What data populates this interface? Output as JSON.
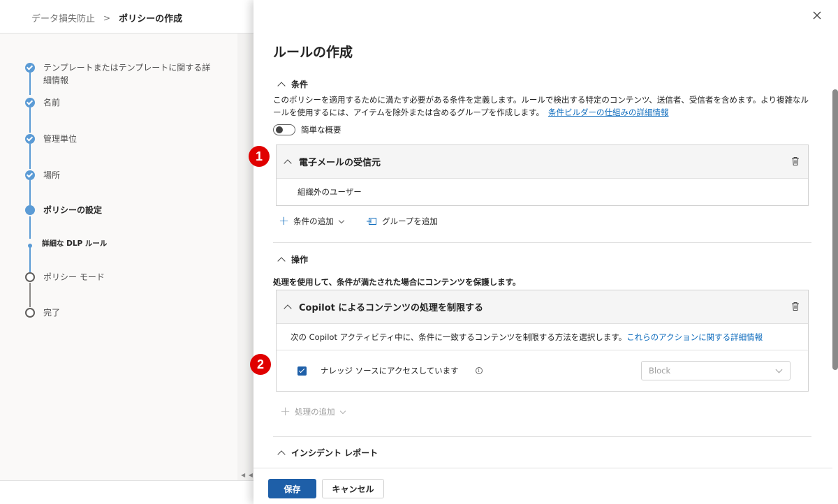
{
  "breadcrumb": {
    "parent": "データ損失防止",
    "separator": ">",
    "current": "ポリシーの作成"
  },
  "wizard": {
    "steps": [
      {
        "label": "テンプレートまたはテンプレートに関する詳細情報",
        "state": "done"
      },
      {
        "label": "名前",
        "state": "done"
      },
      {
        "label": "管理単位",
        "state": "done"
      },
      {
        "label": "場所",
        "state": "done"
      },
      {
        "label": "ポリシーの設定",
        "state": "current"
      },
      {
        "label": "詳細な DLP ルール",
        "state": "current-sub"
      },
      {
        "label": "ポリシー モード",
        "state": "todo"
      },
      {
        "label": "完了",
        "state": "todo"
      }
    ],
    "scroll_arrows": "◀ ◀"
  },
  "panel": {
    "title": "ルールの作成",
    "close_icon": "×",
    "conditions": {
      "header": "条件",
      "description": "このポリシーを適用するために満たす必要がある条件を定義します。ルールで検出する特定のコンテンツ、送信者、受信者を含めます。より複雑なルールを使用するには、アイテムを除外または含めるグループを作成します。",
      "link": "条件ビルダーの仕組みの詳細情報",
      "toggle_label": "簡単な概要",
      "card": {
        "title": "電子メールの受信元",
        "value": "組織外のユーザー"
      },
      "add_condition": "条件の追加",
      "add_group": "グループを追加"
    },
    "actions": {
      "header": "操作",
      "description": "処理を使用して、条件が満たされた場合にコンテンツを保護します。",
      "card": {
        "title": "Copilot によるコンテンツの処理を制限する",
        "description": "次の Copilot アクティビティ中に、条件に一致するコンテンツを制限する方法を選択します。",
        "link": "これらのアクションに関する詳細情報",
        "row_label": "ナレッジ ソースにアクセスしています",
        "info_icon": "i",
        "select_value": "Block"
      },
      "add_action": "処理の追加"
    },
    "incident": {
      "header": "インシデント レポート"
    },
    "footer": {
      "save": "保存",
      "cancel": "キャンセル"
    }
  },
  "annotations": {
    "badge1": "1",
    "badge2": "2",
    "badge_color": "#e00000"
  },
  "colors": {
    "accent": "#1e5fa8",
    "link": "#0f6cbd",
    "step": "#5b9bd5"
  }
}
